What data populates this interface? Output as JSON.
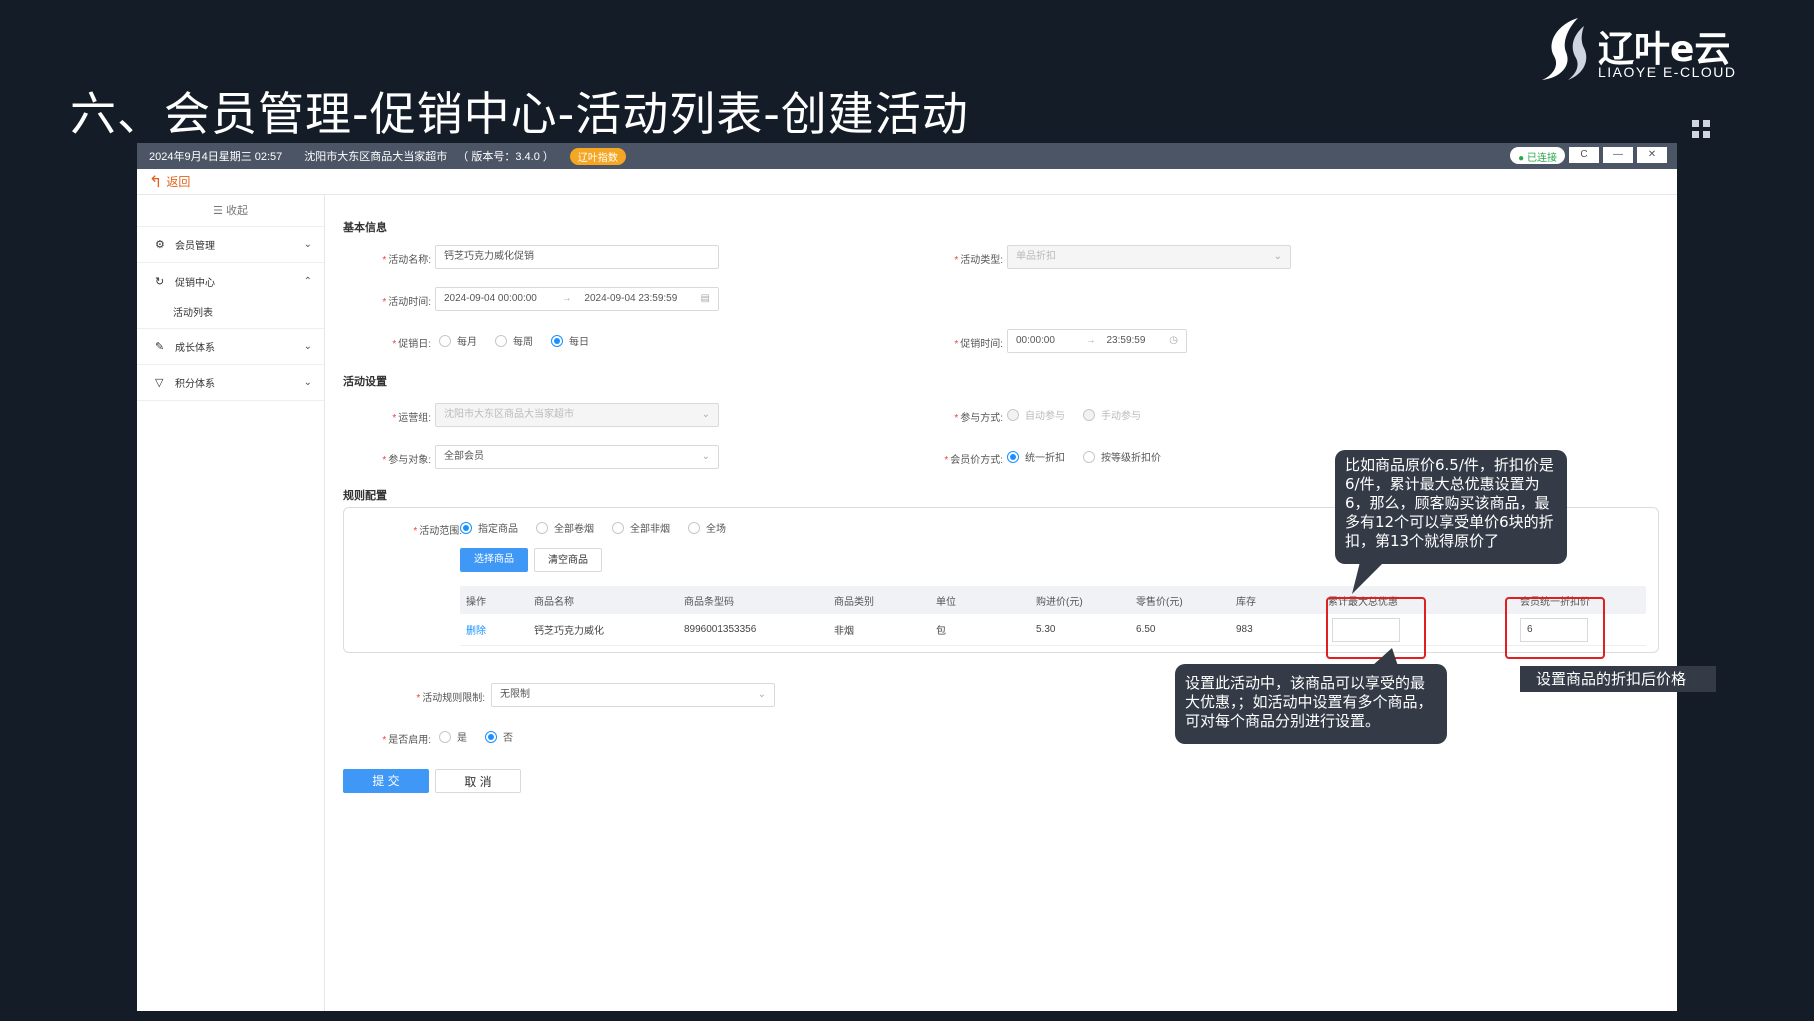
{
  "slide": {
    "title": "六、会员管理-促销中心-活动列表-创建活动",
    "logo_text": "辽叶e云",
    "logo_sub": "LIAOYE E-CLOUD"
  },
  "titlebar": {
    "datetime": "2024年9月4日星期三 02:57",
    "store": "沈阳市大东区商品大当家超市",
    "version": "（ 版本号：3.4.0 ）",
    "badge": "辽叶指数",
    "connection": "已连接",
    "refresh": "C",
    "minimize": "—",
    "close": "✕"
  },
  "back_label": "返回",
  "sidebar": {
    "collapse_label": "收起",
    "items": [
      {
        "label": "会员管理",
        "icon": "gear-icon"
      },
      {
        "label": "促销中心",
        "icon": "refresh-icon",
        "sub": "活动列表"
      },
      {
        "label": "成长体系",
        "icon": "growth-icon"
      },
      {
        "label": "积分体系",
        "icon": "filter-icon"
      }
    ]
  },
  "form": {
    "basic_title": "基本信息",
    "name_label": "活动名称:",
    "name_value": "钙芝巧克力威化促销",
    "type_label": "活动类型:",
    "type_value": "单品折扣",
    "time_label": "活动时间:",
    "time_start": "2024-09-04 00:00:00",
    "time_end": "2024-09-04 23:59:59",
    "promo_day_label": "促销日:",
    "promo_day_options": [
      "每月",
      "每周",
      "每日"
    ],
    "promo_time_label": "促销时间:",
    "promo_time_start": "00:00:00",
    "promo_time_end": "23:59:59",
    "settings_title": "活动设置",
    "ops_group_label": "运营组:",
    "ops_group_value": "沈阳市大东区商品大当家超市",
    "join_mode_label": "参与方式:",
    "join_mode_options": [
      "自动参与",
      "手动参与"
    ],
    "target_label": "参与对象:",
    "target_value": "全部会员",
    "price_mode_label": "会员价方式:",
    "price_mode_options": [
      "统一折扣",
      "按等级折扣价"
    ],
    "rules_title": "规则配置",
    "scope_label": "活动范围:",
    "scope_options": [
      "指定商品",
      "全部卷烟",
      "全部非烟",
      "全场"
    ],
    "select_goods": "选择商品",
    "clear_goods": "清空商品",
    "limit_label": "活动规则限制:",
    "limit_value": "无限制",
    "enable_label": "是否启用:",
    "enable_options": [
      "是",
      "否"
    ],
    "submit": "提 交",
    "cancel": "取 消"
  },
  "table": {
    "headers": [
      "操作",
      "商品名称",
      "商品条型码",
      "商品类别",
      "单位",
      "购进价(元)",
      "零售价(元)",
      "库存",
      "累计最大总优惠",
      "会员统一折扣价"
    ],
    "rows": [
      {
        "op": "删除",
        "name": "钙芝巧克力威化",
        "barcode": "8996001353356",
        "category": "非烟",
        "unit": "包",
        "cost": "5.30",
        "retail": "6.50",
        "stock": "983",
        "max_discount": "",
        "member_price": "6"
      }
    ]
  },
  "callouts": {
    "example": "比如商品原价6.5/件，折扣价是6/件，累计最大总优惠设置为6，那么，顾客购买该商品，最多有12个可以享受单价6块的折扣，第13个就得原价了",
    "max_discount": "设置此活动中，该商品可以享受的最大优惠，；如活动中设置有多个商品，可对每个商品分别进行设置。",
    "member_price": "设置商品的折扣后价格"
  }
}
